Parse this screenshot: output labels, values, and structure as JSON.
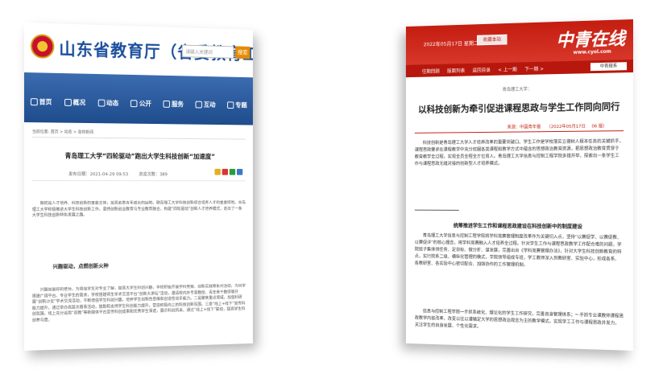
{
  "left": {
    "site_title": "山东省教育厅（省委教育工委）",
    "search_placeholder": "请输入关键词",
    "search_button": "搜索",
    "nav": [
      {
        "label": "首页",
        "icon": "home-icon"
      },
      {
        "label": "概况",
        "icon": "overview-icon"
      },
      {
        "label": "动态",
        "icon": "news-icon"
      },
      {
        "label": "公开",
        "icon": "open-icon"
      },
      {
        "label": "服务",
        "icon": "service-icon"
      },
      {
        "label": "互动",
        "icon": "interaction-icon"
      },
      {
        "label": "专题",
        "icon": "topic-icon"
      }
    ],
    "breadcrumb": "当前位置: 首页 > 动态 > 高校新闻",
    "article_title": "青岛理工大学“四轮驱动”跑出大学生科技创新“加速度”",
    "meta_time": "发布日期：2021-04-29 09:53",
    "meta_views": "浏览次数：389",
    "intro": "期初是人才培养、科技创新的重要主体，是高素质青年成长的园地。期岛理工大学科技创新综合培养人才的重要阵地。青岛理工大学积极推进大学生科技创新工作，坚持创新创业教育与专业教育融合，构建“四轮驱动”创新人才培养模式，走出了一条大学生科技创新特色发展之路。",
    "subheading": "兴趣驱动，点燃创新火种",
    "body": "兴趣是最好的老师，为增强学生对专业了解，提高大学生科创兴趣，学校积极开展学科竞赛、创新实践等系列活动，为同学搭建广阔平台。专业学生的需求，学校搭建师生学术交流平台“创新大讲坛”活动，邀请校内外专家教授、青年骨干教师等开展“创新沙龙”学术交流活动，不断增强学生科创兴趣，培养学生创新性思维和创造性动手能力。二是聚焦重点领域，加强科研能力提升，通过举办高层次赛事活动，鼓励和支持学生科创能力提升，营造积极向上的科技创新氛围。三是“线上+线下”宣传科创氛围，线上充分运用“双微”等新媒体平台宣传科创成果和优秀学生事迹，展示科创风采。通过“线上+线下”联动，提高学生科创参与度。"
  },
  "right": {
    "date": "2022年05月17日 星期二",
    "fav_button": "收藏本站",
    "logo": "中青在线",
    "url": "www.cyol.com",
    "nav": [
      "往期回顾",
      "版面列表",
      "返回目录",
      "< 上一期",
      "下一期 >"
    ],
    "edition_select": "中青报系",
    "kicker": "青岛理工大学：",
    "article_title": "以科技创新为牵引促进课程思政与学生工作同向同行",
    "source": "来源：中国青年报",
    "pub_date": "（2022年05月17日",
    "page_no": "06 版）",
    "para1": "科技创新是青岛理工大学人才培养改革的重要突破口。学生工作是学校落实立德树人根本任务的关键抓手，课程思政要求在课程教学中充分挖掘各类课程和教学方式中蕴含的思想政治教育资源，把思想政治教育贯穿于教育教学全过程，实现全员全程全方位育人。青岛理工大学信息与控制工程学院多措并举，探索出一条学生工作与课程思政无缝对接的创新型人才培养模式。",
    "subheading": "统筹推进学生工作和课程思政建设在科技创新中的制度建设",
    "para2": "青岛理工大学信息与控制工程学院将学科竞赛管理制度改革作为关键切入点，坚持“以赛促学、以赛促教、以赛促评”的核心理念，将学科竞赛融入人才培养全过程。针对学生工作与课程思政教学工作配合难的问题，学院班子集体领任务、定目标、做分析、谋发展，完善出台《学科竞赛管理办法》，针对大学生科技创新教育的特点，实行院系二级、横纵化管理的模式，学院领导组成专班，学工教师深入到教研室、实验中心，形成各系、各教研室、各实验中心密切配合、加强协作的工作管理机制。",
    "para3": "信息与控制工程学院一手抓系统化、理论化的学生工作研究，完善自身管理体系；一手抓专业课教师课程思政教学内容改革，改变以往以灌输定大学的思想政治观念为主的教学模式。实现学工工作与课程思政并发力，关注学生的自身发展、个性化需求。"
  }
}
